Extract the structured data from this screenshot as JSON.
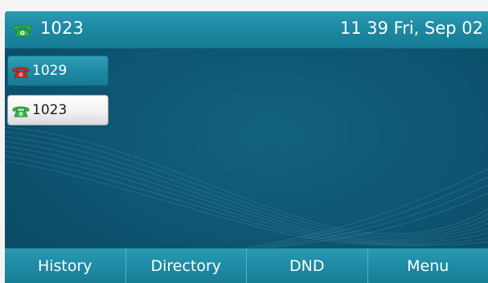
{
  "status_bar": {
    "account": "1023",
    "account_icon": "phone-handset-green-icon",
    "datetime": "11 39 Fri, Sep 02"
  },
  "line_keys": [
    {
      "label": "1029",
      "icon": "phone-handset-red-icon",
      "state": "idle"
    },
    {
      "label": "1023",
      "icon": "phone-handset-green-icon",
      "state": "selected"
    }
  ],
  "softkeys": [
    {
      "label": "History"
    },
    {
      "label": "Directory"
    },
    {
      "label": "DND"
    },
    {
      "label": "Menu"
    }
  ],
  "colors": {
    "screen_bg": "#0d5470",
    "bar_accent": "#1d8aa3",
    "handset_green": "#2fae3a",
    "handset_red": "#c8231f"
  }
}
